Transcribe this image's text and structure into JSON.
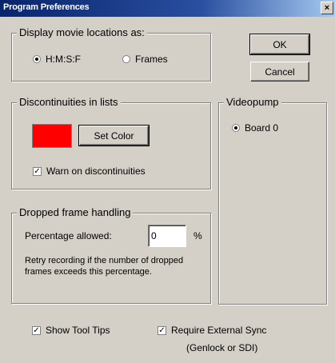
{
  "window": {
    "title": "Program Preferences",
    "close_glyph": "×"
  },
  "display_group": {
    "legend": "Display movie locations as:",
    "options": [
      {
        "label": "H:M:S:F",
        "selected": true
      },
      {
        "label": "Frames",
        "selected": false
      }
    ]
  },
  "buttons": {
    "ok": "OK",
    "cancel": "Cancel"
  },
  "discontinuities_group": {
    "legend": "Discontinuities in lists",
    "swatch_color": "#ff0000",
    "set_color_label": "Set Color",
    "warn_label": "Warn on discontinuities",
    "warn_checked": true
  },
  "videopump_group": {
    "legend": "Videopump",
    "board_label": "Board 0",
    "board_selected": true
  },
  "dropped_group": {
    "legend": "Dropped frame handling",
    "percentage_label": "Percentage allowed:",
    "percentage_value": "0",
    "percent_unit": "%",
    "retry_text": "Retry recording if the number of dropped frames exceeds this percentage."
  },
  "footer": {
    "show_tooltips_label": "Show Tool Tips",
    "show_tooltips_checked": true,
    "require_sync_label": "Require External Sync",
    "require_sync_sublabel": "(Genlock or SDI)",
    "require_sync_checked": true
  }
}
